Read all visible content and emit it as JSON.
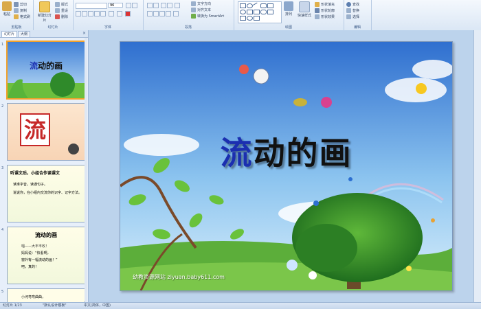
{
  "ribbon": {
    "clipboard": {
      "paste": "粘贴",
      "cut": "剪切",
      "copy": "复制",
      "format_painter": "格式刷",
      "label": "剪贴板"
    },
    "slides": {
      "new_slide": "新建幻灯片",
      "layout": "版式",
      "reset": "重设",
      "delete": "删除",
      "label": "幻灯片"
    },
    "font": {
      "font_size": "96",
      "label": "字体"
    },
    "paragraph": {
      "text_direction": "文字方向",
      "align_text": "对齐文本",
      "convert_smartart": "转换为 SmartArt",
      "label": "段落"
    },
    "drawing": {
      "arrange": "排列",
      "quick_styles": "快速样式",
      "shape_fill": "形状填充",
      "shape_outline": "形状轮廓",
      "shape_effects": "形状效果",
      "label": "绘图"
    },
    "editing": {
      "find": "查找",
      "replace": "替换",
      "select": "选择",
      "label": "编辑"
    }
  },
  "pane": {
    "tabs": [
      "幻灯片",
      "大纲"
    ],
    "close": "×",
    "thumbs": [
      {
        "num": "1",
        "title": "流动的画"
      },
      {
        "num": "2",
        "char": "流"
      },
      {
        "num": "3",
        "heading": "听课文后，小组合作读课文",
        "bullets": [
          "读字音",
          "读准字音，读通句子。",
          "说说你，在小组内交流你的识字、记字方法。"
        ]
      },
      {
        "num": "4",
        "heading": "流动的画",
        "lines": [
          "唱——大丰丰收！",
          "妈妈说：“快看啊，",
          "窗外有一幅流动的画！”",
          "吧，真的！"
        ]
      },
      {
        "num": "5",
        "lines": [
          "小河弯弯曲曲，"
        ]
      }
    ]
  },
  "slide": {
    "title_part1": "流",
    "title_part2": "动的画",
    "watermark": "幼教资源网站  ziyuan.baby611.com"
  },
  "status": {
    "slide_info": "幻灯片 1/23",
    "theme": "\"默认设计模板\"",
    "language": "中文(简体，中国)"
  },
  "colors": {
    "sky_top": "#3f7fd6",
    "sky_bottom": "#bfe0f7",
    "grass": "#5cae3a",
    "title_blue": "#1b2fb0",
    "selected_border": "#f2a22c"
  }
}
